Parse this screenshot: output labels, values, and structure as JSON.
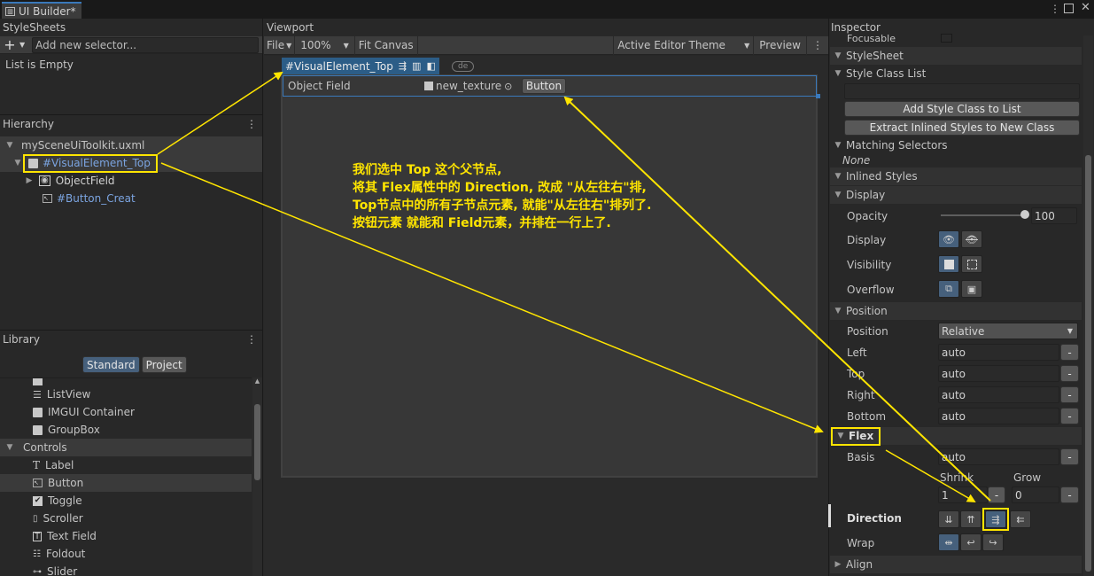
{
  "tab": {
    "title": "UI Builder*"
  },
  "stylesheets": {
    "title": "StyleSheets",
    "add_icon": "+",
    "selector_placeholder": "Add new selector...",
    "empty_text": "List is Empty"
  },
  "hierarchy": {
    "title": "Hierarchy",
    "file": "mySceneUiToolkit.uxml",
    "items": [
      {
        "label": "#VisualElement_Top"
      },
      {
        "label": "ObjectField"
      },
      {
        "label": "#Button_Creat"
      }
    ]
  },
  "library": {
    "title": "Library",
    "tabs": [
      "Standard",
      "Project"
    ],
    "items": [
      "ListView",
      "IMGUI Container",
      "GroupBox"
    ],
    "controls_header": "Controls",
    "controls": [
      "Label",
      "Button",
      "Toggle",
      "Scroller",
      "Text Field",
      "Foldout",
      "Slider"
    ]
  },
  "viewport": {
    "title": "Viewport",
    "file_menu": "File",
    "zoom": "100%",
    "fit_canvas": "Fit Canvas",
    "theme": "Active Editor Theme",
    "preview": "Preview",
    "selected_label": "#VisualElement_Top",
    "mode_chip": "de",
    "object_field_label": "Object Field",
    "object_field_value": "new_texture",
    "button_label": "Button"
  },
  "annotation": {
    "lines": [
      "我们选中 Top 这个父节点,",
      "将其 Flex属性中的 Direction, 改成 \"从左往右\"排,",
      "Top节点中的所有子节点元素, 就能\"从左往右\"排列了.",
      "按钮元素 就能和 Field元素，并排在一行上了."
    ],
    "color": "#ffe500"
  },
  "inspector": {
    "title": "Inspector",
    "focusable": "Focusable",
    "stylesheet_section": "StyleSheet",
    "style_class_list": "Style Class List",
    "add_style_class": "Add Style Class to List",
    "extract_inline": "Extract Inlined Styles to New Class",
    "matching_selectors": "Matching Selectors",
    "none": "None",
    "inlined_styles": "Inlined Styles",
    "display_section": "Display",
    "opacity_label": "Opacity",
    "opacity_value": "100",
    "opacity_fraction": 1.0,
    "display_label": "Display",
    "visibility_label": "Visibility",
    "overflow_label": "Overflow",
    "position_section": "Position",
    "position_label": "Position",
    "position_value": "Relative",
    "left_label": "Left",
    "left_value": "auto",
    "top_label": "Top",
    "top_value": "auto",
    "right_label": "Right",
    "right_value": "auto",
    "bottom_label": "Bottom",
    "bottom_value": "auto",
    "minus": "-",
    "flex_section": "Flex",
    "basis_label": "Basis",
    "basis_value": "auto",
    "shrink_label": "Shrink",
    "shrink_value": "1",
    "grow_label": "Grow",
    "grow_value": "0",
    "direction_label": "Direction",
    "wrap_label": "Wrap",
    "align_section": "Align"
  },
  "colors": {
    "accent": "#3a79bb",
    "selection": "#2c5d87",
    "annotation": "#ffe500"
  }
}
